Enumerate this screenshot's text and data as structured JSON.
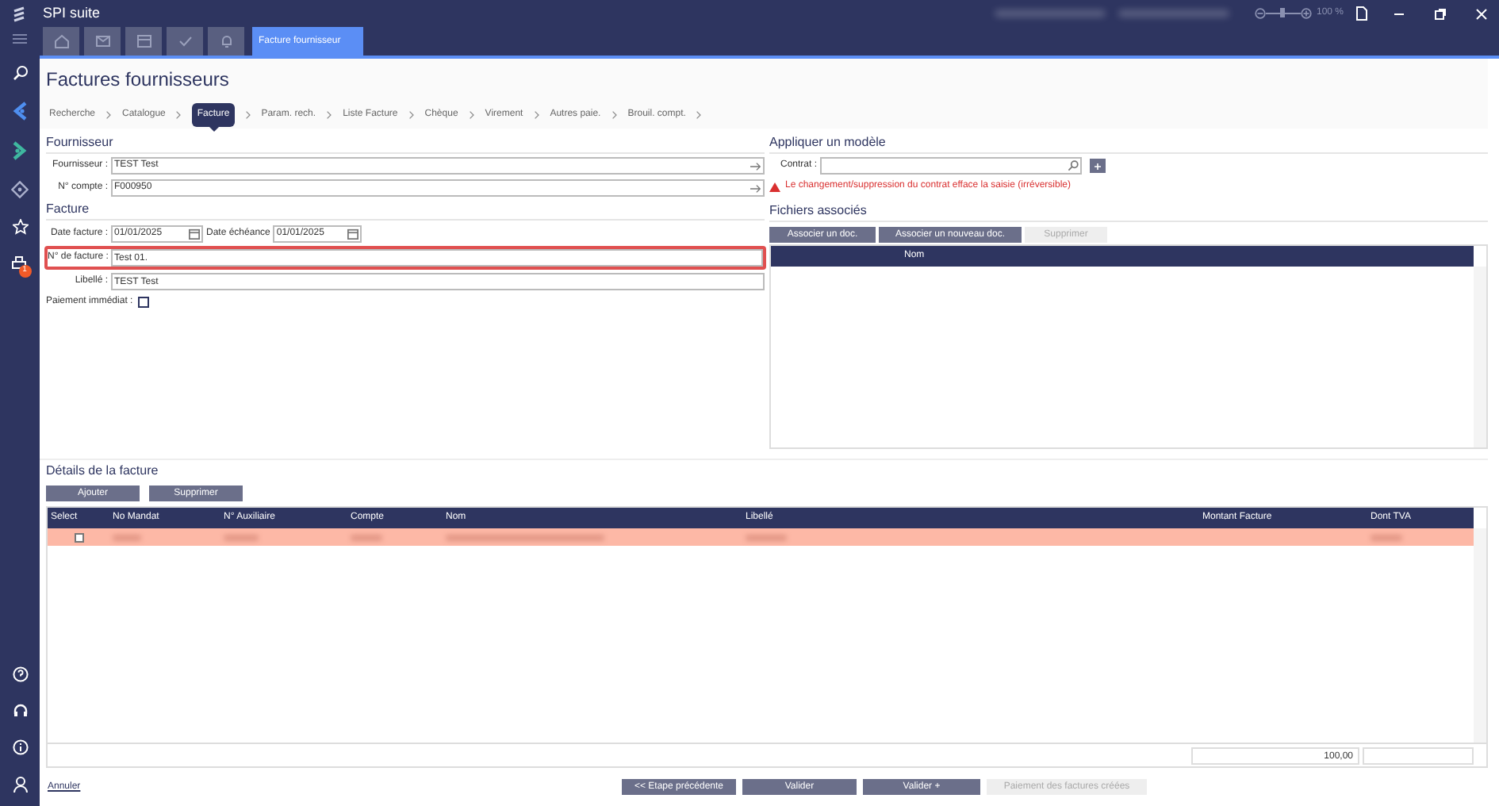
{
  "window": {
    "title": "SPI suite",
    "zoom": "100 %",
    "zoom_slider": {
      "level": 0.45
    }
  },
  "tabs": [
    {
      "kind": "icon",
      "selected": false
    },
    {
      "kind": "icon",
      "selected": false
    },
    {
      "kind": "icon",
      "selected": false
    },
    {
      "kind": "icon",
      "selected": false
    },
    {
      "kind": "icon",
      "selected": false
    },
    {
      "kind": "text",
      "label": "Facture fournisseur",
      "selected": true
    }
  ],
  "sidebar": {
    "badge": "1"
  },
  "page_title": "Factures fournisseurs",
  "steps": [
    {
      "label": "Recherche",
      "selected": false
    },
    {
      "label": "Catalogue",
      "selected": false
    },
    {
      "label": "Facture",
      "selected": true
    },
    {
      "label": "Param. rech.",
      "selected": false
    },
    {
      "label": "Liste Facture",
      "selected": false
    },
    {
      "label": "Chèque",
      "selected": false
    },
    {
      "label": "Virement",
      "selected": false
    },
    {
      "label": "Autres paie.",
      "selected": false
    },
    {
      "label": "Brouil. compt.",
      "selected": false
    }
  ],
  "fournisseur": {
    "heading": "Fournisseur",
    "fields": [
      {
        "label": "Fournisseur :",
        "value": "TEST Test"
      },
      {
        "label": "N° compte :",
        "value": "F000950"
      }
    ]
  },
  "modele": {
    "heading": "Appliquer un modèle",
    "label": "Contrat :",
    "warning": "Le changement/suppression du contrat efface la saisie (irréversible)"
  },
  "facture": {
    "heading": "Facture",
    "date_label": "Date facture :",
    "date_value": "01/01/2025",
    "due_label": "Date échéance",
    "due_value": "01/01/2025",
    "fields": [
      {
        "label": "N° de facture :",
        "value": "Test 01.",
        "invalid": true
      },
      {
        "label": "Libellé :",
        "value": "TEST Test",
        "invalid": false
      }
    ],
    "immediate_label": "Paiement immédiat :",
    "immediate_checked": false
  },
  "fichiers": {
    "heading": "Fichiers associés",
    "buttons": [
      {
        "label": "Associer un doc.",
        "disabled": false
      },
      {
        "label": "Associer un nouveau doc.",
        "disabled": false
      },
      {
        "label": "Supprimer",
        "disabled": true
      }
    ],
    "columns": [
      "Nom"
    ]
  },
  "details": {
    "heading": "Détails de la facture",
    "buttons": [
      {
        "label": "Ajouter",
        "disabled": false
      },
      {
        "label": "Supprimer",
        "disabled": false
      }
    ],
    "columns": [
      "Select",
      "No Mandat",
      "N° Auxiliaire",
      "Compte",
      "Nom",
      "Libellé",
      "Montant Facture",
      "Dont TVA"
    ],
    "rows": [
      {
        "selected": true,
        "checked": false
      }
    ],
    "total": "100,00"
  },
  "footer": {
    "cancel": "Annuler",
    "buttons": [
      {
        "label": "<< Etape précédente",
        "disabled": false
      },
      {
        "label": "Valider",
        "disabled": false
      },
      {
        "label": "Valider +",
        "disabled": false
      },
      {
        "label": "Paiement des factures créées",
        "disabled": true
      }
    ]
  }
}
